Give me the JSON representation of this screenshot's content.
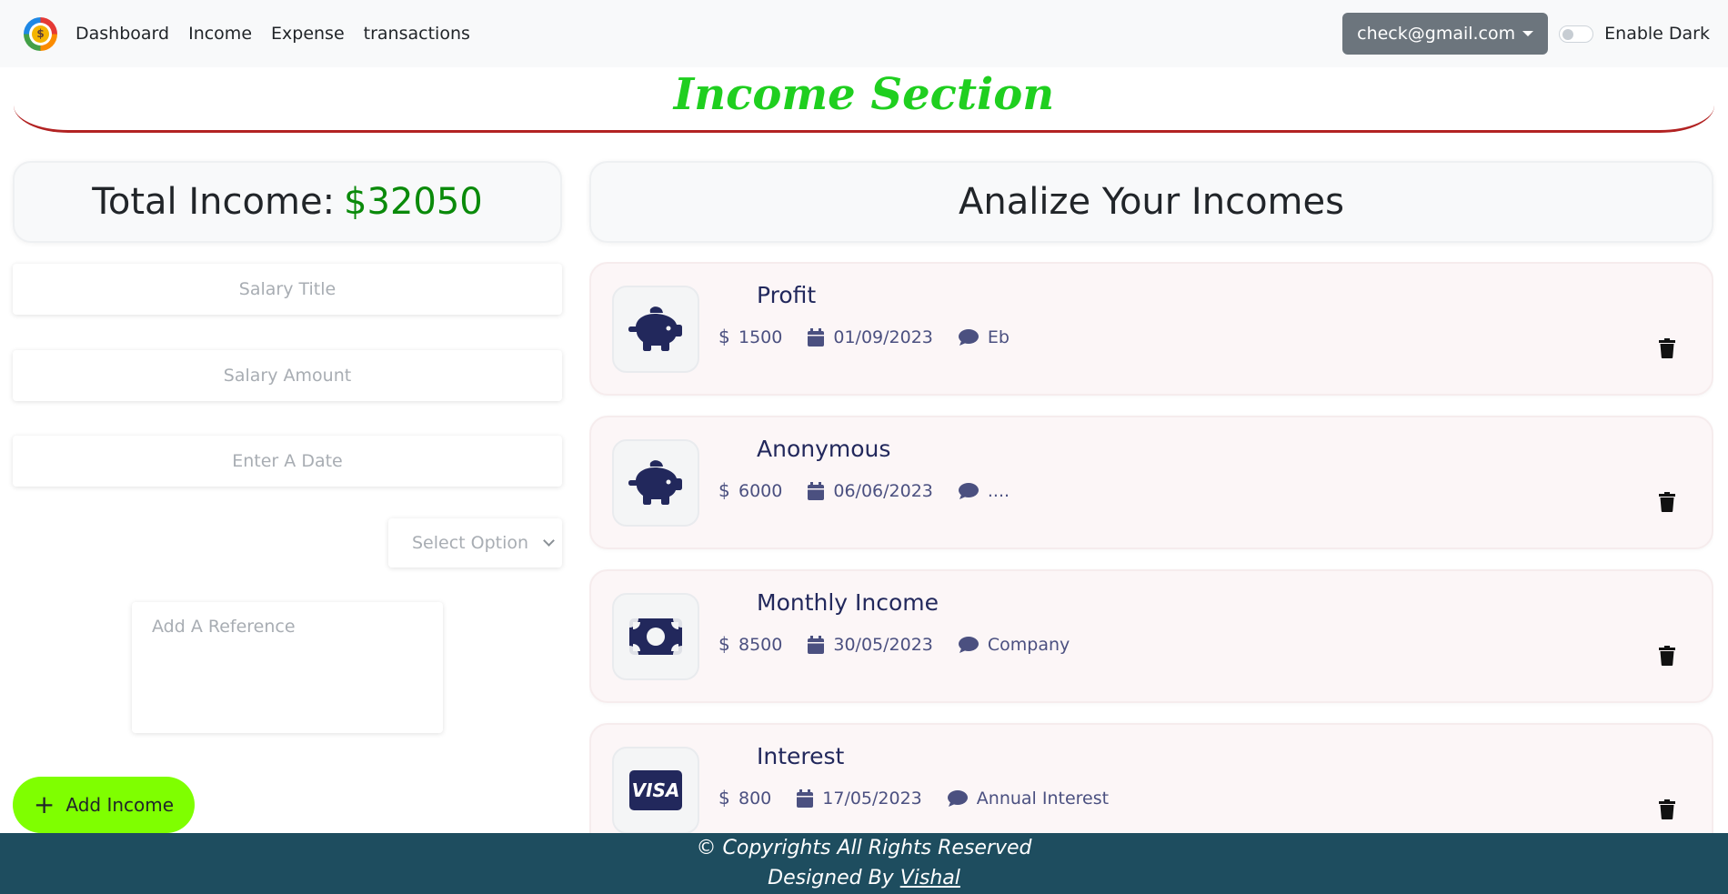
{
  "navbar": {
    "links": [
      "Dashboard",
      "Income",
      "Expense",
      "transactions"
    ],
    "user_email": "check@gmail.com",
    "dark_toggle_label": "Enable Dark",
    "dark_enabled": false
  },
  "section": {
    "title": "Income Section"
  },
  "summary": {
    "label": "Total Income:",
    "amount": "$32050"
  },
  "form": {
    "salary_title_placeholder": "Salary Title",
    "salary_amount_placeholder": "Salary Amount",
    "date_placeholder": "Enter A Date",
    "select_placeholder": "Select Option",
    "reference_placeholder": "Add A Reference",
    "add_label": "Add Income"
  },
  "analysis": {
    "title": "Analize Your Incomes"
  },
  "incomes": [
    {
      "title": "Profit",
      "amount": "1500",
      "date": "01/09/2023",
      "note": "Eb",
      "icon": "piggy-bank-icon"
    },
    {
      "title": "Anonymous",
      "amount": "6000",
      "date": "06/06/2023",
      "note": "....",
      "icon": "piggy-bank-icon"
    },
    {
      "title": "Monthly Income",
      "amount": "8500",
      "date": "30/05/2023",
      "note": "Company",
      "icon": "money-bill-icon"
    },
    {
      "title": "Interest",
      "amount": "800",
      "date": "17/05/2023",
      "note": "Annual Interest",
      "icon": "visa-card-icon"
    }
  ],
  "footer": {
    "copyright": "© Copyrights All Rights Reserved",
    "designed_by": "Designed By",
    "author": "Vishal"
  },
  "colors": {
    "title_green": "#1fcf1f",
    "amount_green": "#0a8a0a",
    "button_green": "#7fff00",
    "footer_bg": "#1e4d5f",
    "icon_navy": "#22285c",
    "heading_underline": "#b22222"
  }
}
